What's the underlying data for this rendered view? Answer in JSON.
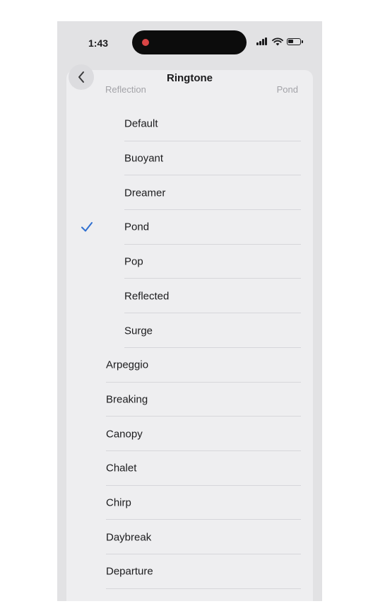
{
  "status_bar": {
    "time": "1:43"
  },
  "header": {
    "title": "Ringtone",
    "behind_left": "Reflection",
    "behind_right": "Pond"
  },
  "selected": "Pond",
  "accent_color": "#2f6fd0",
  "sub_list": [
    {
      "label": "Default"
    },
    {
      "label": "Buoyant"
    },
    {
      "label": "Dreamer"
    },
    {
      "label": "Pond",
      "checked": true
    },
    {
      "label": "Pop"
    },
    {
      "label": "Reflected"
    },
    {
      "label": "Surge"
    }
  ],
  "main_list": [
    {
      "label": "Arpeggio"
    },
    {
      "label": "Breaking"
    },
    {
      "label": "Canopy"
    },
    {
      "label": "Chalet"
    },
    {
      "label": "Chirp"
    },
    {
      "label": "Daybreak"
    },
    {
      "label": "Departure"
    }
  ],
  "icons": {
    "back": "chevron-left-icon",
    "check": "checkmark-icon",
    "signal": "cellular-signal-icon",
    "wifi": "wifi-icon",
    "battery": "battery-icon",
    "recording": "recording-dot-icon"
  }
}
